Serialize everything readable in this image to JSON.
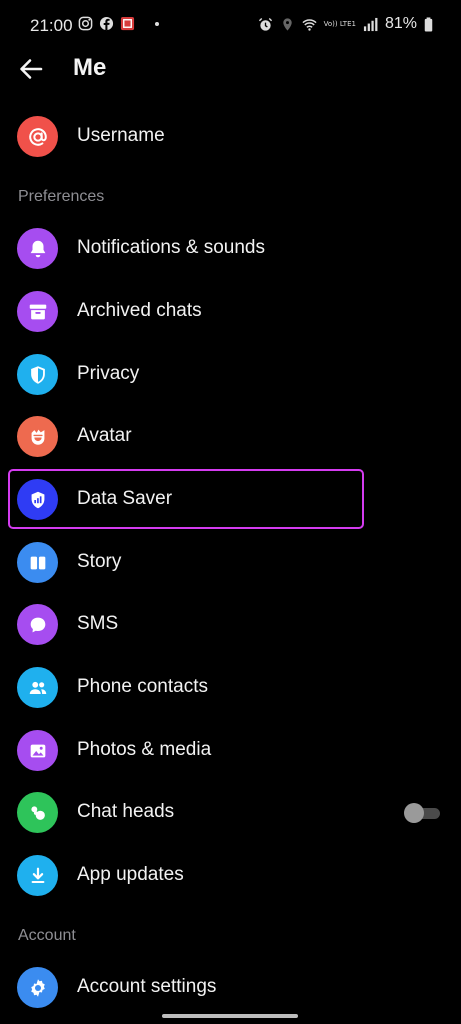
{
  "status": {
    "time": "21:00",
    "battery": "81%",
    "volte": "Vo)) LTE1"
  },
  "header": {
    "title": "Me"
  },
  "items": {
    "username": "Username",
    "notifications": "Notifications & sounds",
    "archived": "Archived chats",
    "privacy": "Privacy",
    "avatar": "Avatar",
    "data_saver": "Data Saver",
    "story": "Story",
    "sms": "SMS",
    "phone_contacts": "Phone contacts",
    "photos_media": "Photos & media",
    "chat_heads": "Chat heads",
    "app_updates": "App updates",
    "account_settings": "Account settings"
  },
  "sections": {
    "preferences": "Preferences",
    "account": "Account"
  },
  "toggles": {
    "chat_heads_on": false
  },
  "colors": {
    "username": "#f0514a",
    "notifications": "#a64df0",
    "archived": "#a64df0",
    "privacy": "#1fb0ee",
    "avatar": "#ee6a4f",
    "data_saver": "#2f3cf4",
    "story": "#3b8cf0",
    "sms": "#a64df0",
    "phone_contacts": "#1fb0ee",
    "photos_media": "#a64df0",
    "chat_heads": "#2ec45a",
    "app_updates": "#1fb0ee",
    "account_settings": "#3b8cf0",
    "highlight": "#d43cf0"
  }
}
